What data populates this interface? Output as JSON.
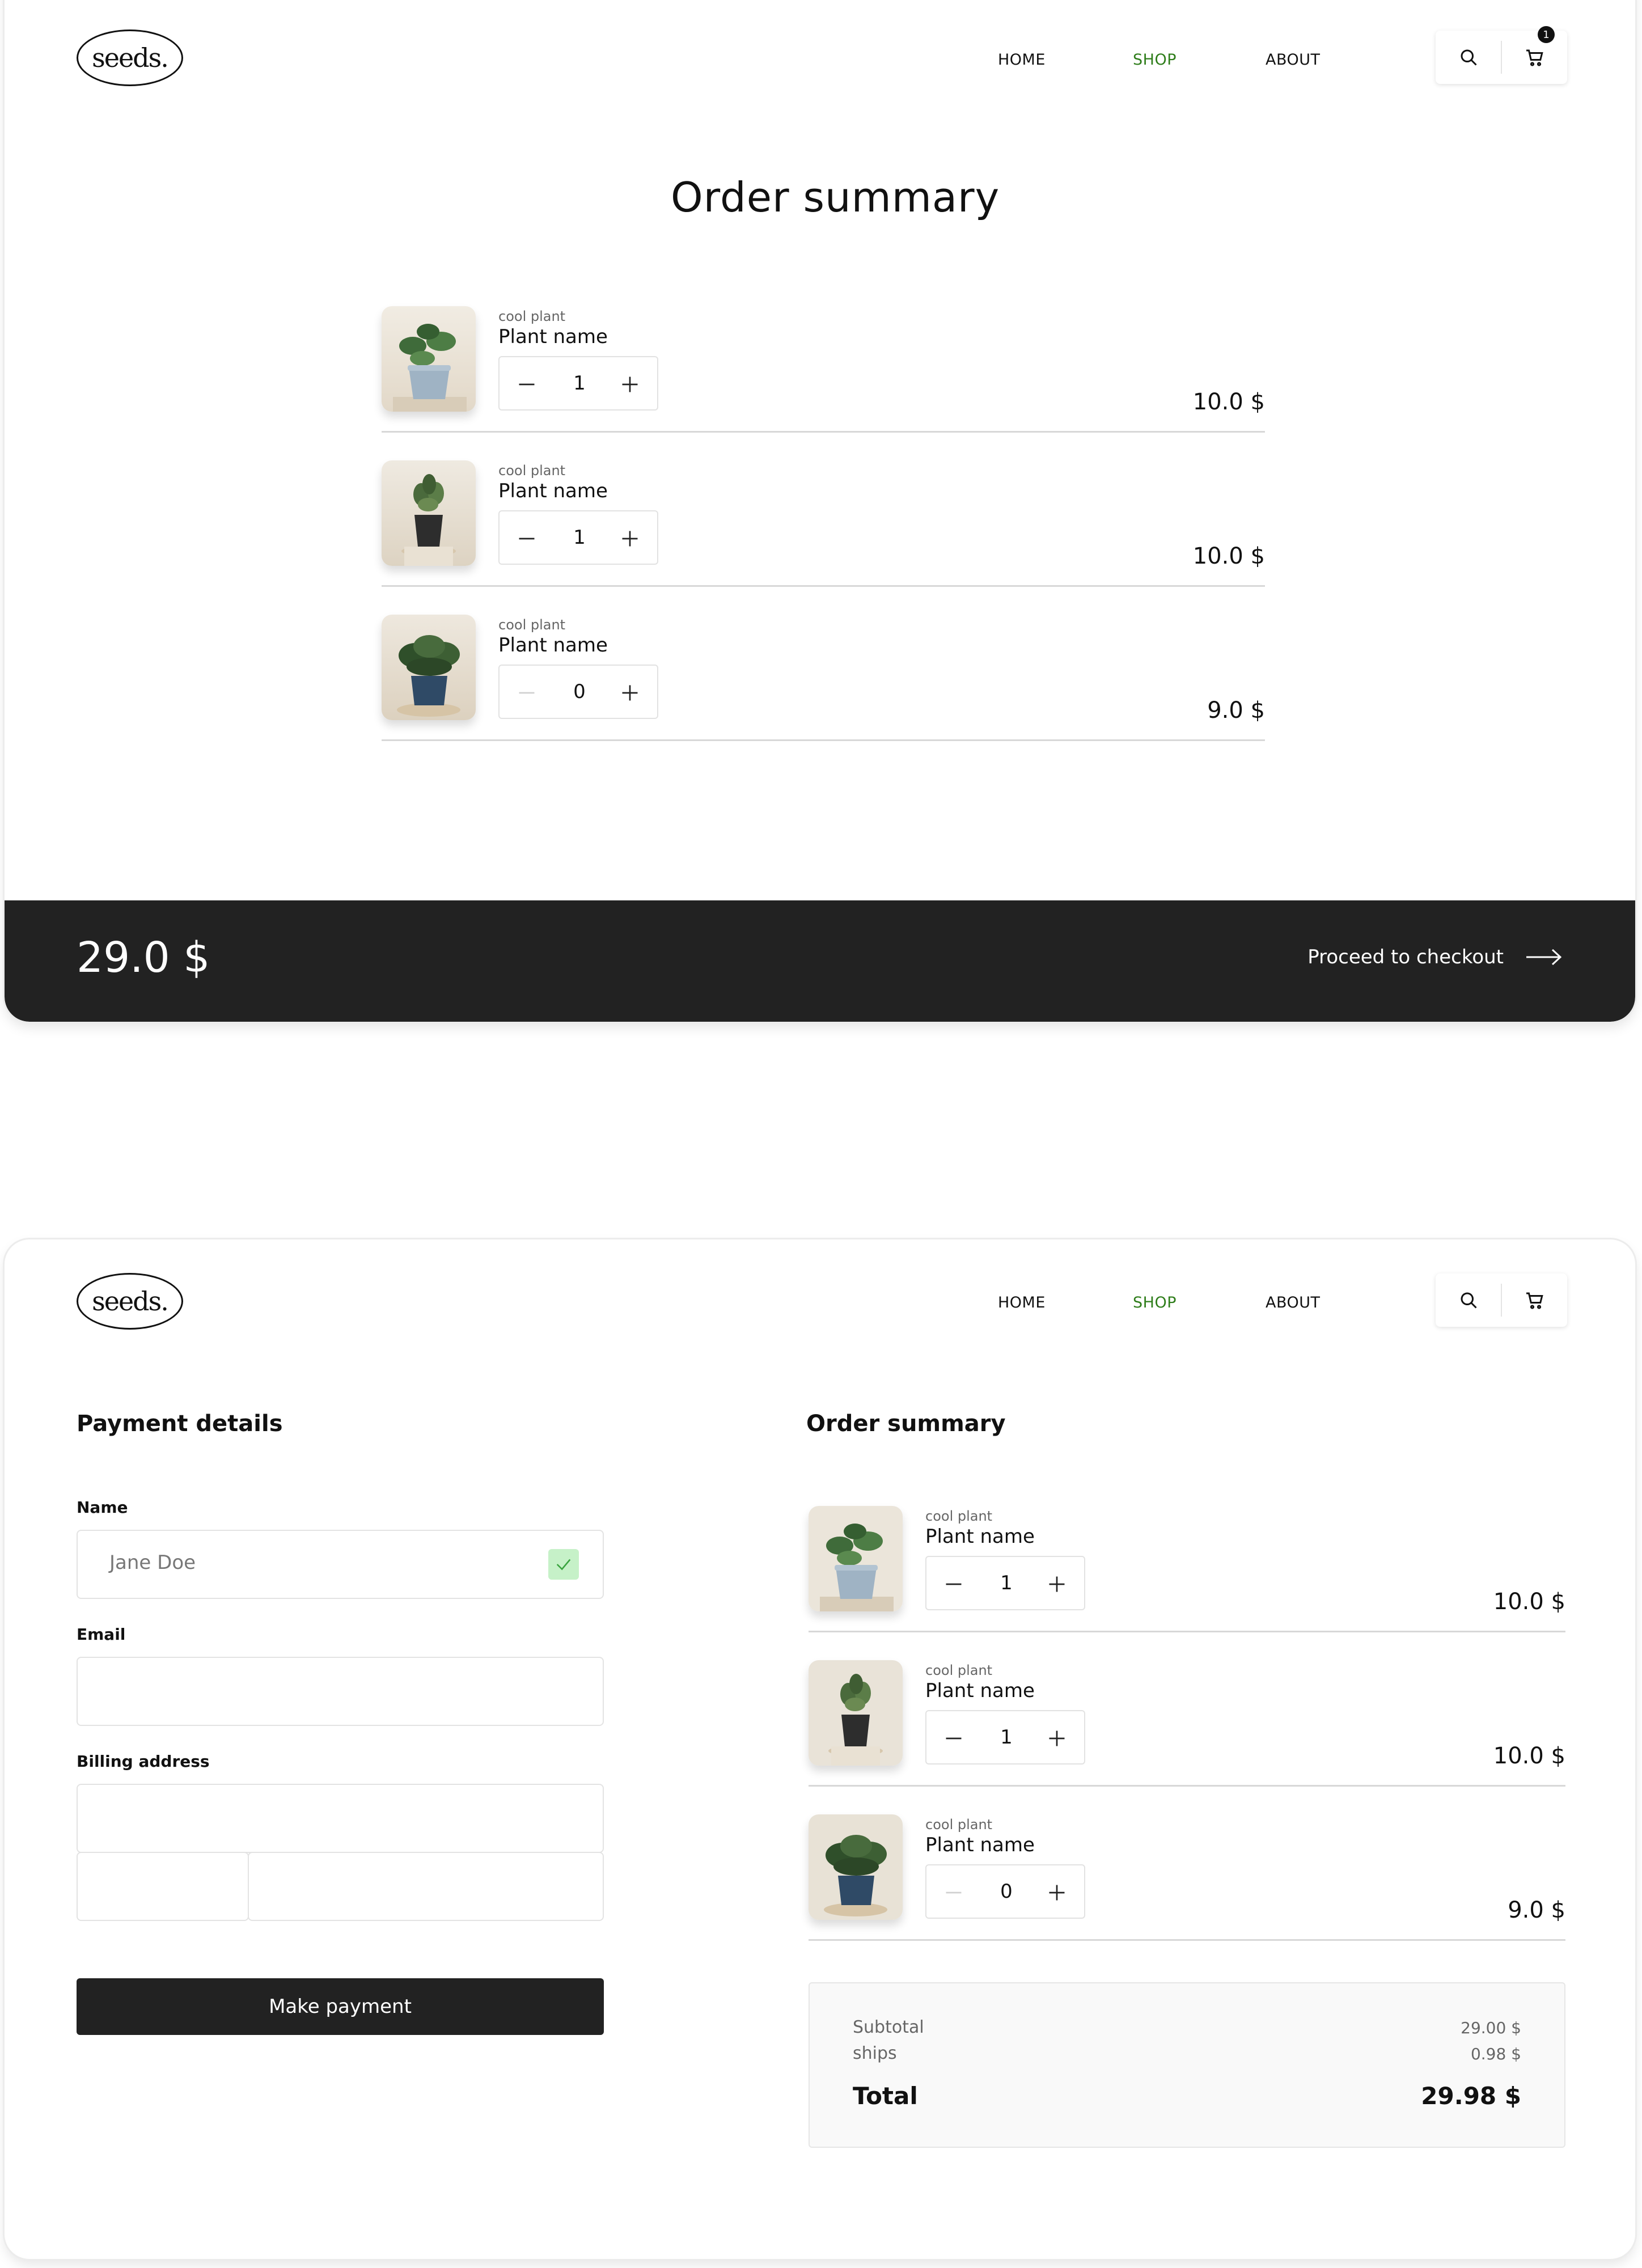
{
  "brand": {
    "logo": "seeds."
  },
  "nav": {
    "home": "HOME",
    "shop": "SHOP",
    "about": "ABOUT",
    "cart_count": "1"
  },
  "cart_page": {
    "title": "Order summary",
    "items": [
      {
        "category": "cool plant",
        "name": "Plant name",
        "quantity": "1",
        "price": "10.0 $"
      },
      {
        "category": "cool plant",
        "name": "Plant name",
        "quantity": "1",
        "price": "10.0 $"
      },
      {
        "category": "cool plant",
        "name": "Plant name",
        "quantity": "0",
        "price": "9.0 $"
      }
    ],
    "total": "29.0 $",
    "checkout_label": "Proceed to checkout"
  },
  "payment_page": {
    "payment_title": "Payment details",
    "name_label": "Name",
    "name_value": "Jane Doe",
    "email_label": "Email",
    "email_value": "",
    "billing_label": "Billing address",
    "pay_button": "Make payment",
    "summary_title": "Order summary",
    "items": [
      {
        "category": "cool plant",
        "name": "Plant name",
        "quantity": "1",
        "price": "10.0 $"
      },
      {
        "category": "cool plant",
        "name": "Plant name",
        "quantity": "1",
        "price": "10.0 $"
      },
      {
        "category": "cool plant",
        "name": "Plant name",
        "quantity": "0",
        "price": "9.0 $"
      }
    ],
    "subtotal_label": "Subtotal",
    "subtotal_value": "29.00 $",
    "shipping_label": "ships",
    "shipping_value": "0.98 $",
    "total_label": "Total",
    "total_value": "29.98 $"
  },
  "colors": {
    "accent": "#2e7d1a",
    "dark": "#222222",
    "success_bg": "#c6f1c8"
  },
  "icons": [
    "search-icon",
    "cart-icon",
    "minus-icon",
    "plus-icon",
    "arrow-right-icon",
    "check-icon",
    "plant-photo"
  ]
}
